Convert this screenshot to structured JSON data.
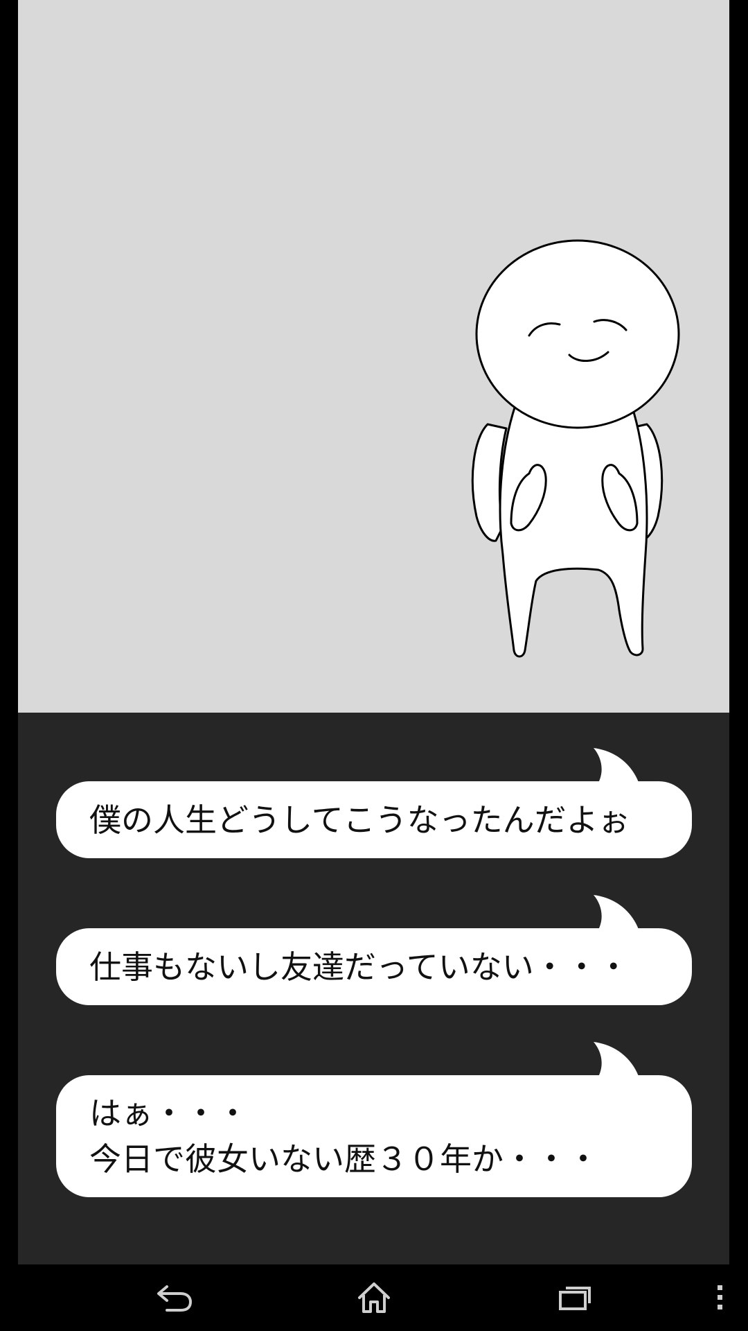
{
  "colors": {
    "scene_background": "#d9d9d9",
    "dialog_background": "#262626",
    "bubble_fill": "#ffffff",
    "bubble_text": "#111111",
    "navbar_background": "#000000",
    "navbar_icons": "#cfcfcf"
  },
  "scene": {
    "character": "white-stick-figure-with-backpack-smiling"
  },
  "dialog": {
    "bubbles": [
      {
        "lines": [
          "僕の人生どうしてこうなったんだよぉ"
        ]
      },
      {
        "lines": [
          "仕事もないし友達だっていない・・・"
        ]
      },
      {
        "lines": [
          "はぁ・・・",
          "今日で彼女いない歴３０年か・・・"
        ]
      }
    ]
  },
  "navbar": {
    "icons": [
      "back-icon",
      "home-icon",
      "recent-apps-icon",
      "overflow-menu-icon"
    ]
  }
}
